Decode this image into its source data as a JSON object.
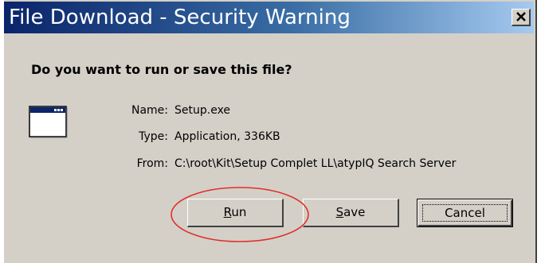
{
  "window": {
    "title": "File Download - Security Warning",
    "close_glyph": "×"
  },
  "dialog": {
    "question": "Do you want to run or save this file?",
    "file_icon": "application-window-icon",
    "fields": [
      {
        "label": "Name:",
        "value": "Setup.exe"
      },
      {
        "label": "Type:",
        "value": "Application, 336KB"
      },
      {
        "label": "From:",
        "value": "C:\\root\\Kit\\Setup Complet LL\\atypIQ Search Server"
      }
    ]
  },
  "buttons": {
    "run": {
      "mnemonic": "R",
      "rest": "un"
    },
    "save": {
      "mnemonic": "S",
      "rest": "ave"
    },
    "cancel": {
      "label": "Cancel"
    }
  },
  "annotation": {
    "color": "#e0302a"
  },
  "colors": {
    "face": "#d4d0c8",
    "title_start": "#0a246a",
    "title_end": "#a6caf0"
  }
}
